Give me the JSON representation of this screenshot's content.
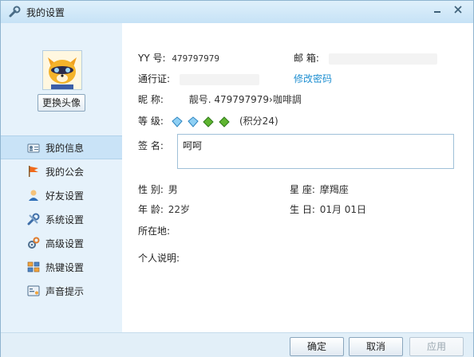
{
  "window": {
    "title": "我的设置",
    "controls": [
      "minimize",
      "close"
    ]
  },
  "sidebar": {
    "change_avatar_label": "更换头像",
    "items": [
      {
        "label": "我的信息",
        "icon": "id-card-icon",
        "active": true
      },
      {
        "label": "我的公会",
        "icon": "flag-icon",
        "active": false
      },
      {
        "label": "好友设置",
        "icon": "person-icon",
        "active": false
      },
      {
        "label": "系统设置",
        "icon": "wrench-icon",
        "active": false
      },
      {
        "label": "高级设置",
        "icon": "gears-icon",
        "active": false
      },
      {
        "label": "热键设置",
        "icon": "keyboard-icon",
        "active": false
      },
      {
        "label": "声音提示",
        "icon": "sound-icon",
        "active": false
      }
    ]
  },
  "profile": {
    "yy_label": "YY  号:",
    "yy_value": "479797979",
    "email_label": "邮  箱:",
    "pass_label": "通行证:",
    "change_password": "修改密码",
    "nick_label": "昵  称:",
    "nick_value": "靓号. 479797979›咖啡調",
    "level_label": "等  级:",
    "level_score": "(积分24)",
    "signature_label": "签  名:",
    "signature_value": "呵呵",
    "gender_label": "性  别:",
    "gender_value": "男",
    "zodiac_label": "星  座:",
    "zodiac_value": "摩羯座",
    "age_label": "年  龄:",
    "age_value": "22岁",
    "birthday_label": "生  日:",
    "birthday_value": "01月  01日",
    "location_label": "所在地:",
    "location_value": "",
    "bio_label": "个人说明:",
    "bio_value": ""
  },
  "footer": {
    "ok_label": "确定",
    "cancel_label": "取消",
    "apply_label": "应用"
  },
  "colors": {
    "link": "#1f8fd1",
    "sidebar_bg": "#e6f2fb",
    "active_item": "#c9e3f7"
  }
}
